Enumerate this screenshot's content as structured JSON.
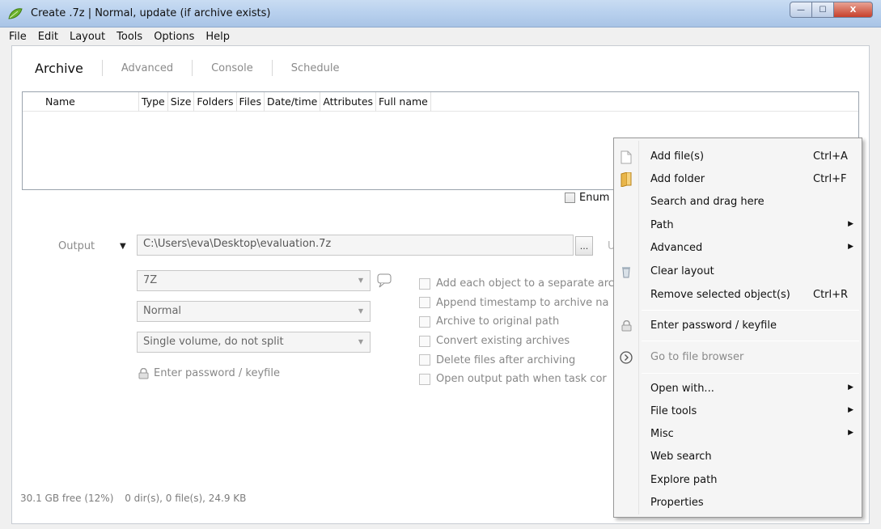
{
  "window": {
    "title": "Create .7z | Normal, update (if archive exists)",
    "buttons": {
      "minimize": "—",
      "maximize": "☐",
      "close": "X"
    }
  },
  "menubar": [
    "File",
    "Edit",
    "Layout",
    "Tools",
    "Options",
    "Help"
  ],
  "tabs": [
    "Archive",
    "Advanced",
    "Console",
    "Schedule"
  ],
  "active_tab": "Archive",
  "file_list": {
    "columns": [
      "Name",
      "Type",
      "Size",
      "Folders",
      "Files",
      "Date/time",
      "Attributes",
      "Full name"
    ],
    "rows": []
  },
  "enum_checkbox_label": "Enum",
  "output": {
    "label": "Output",
    "caret": "▼",
    "path": "C:\\Users\\eva\\Desktop\\evaluation.7z",
    "browse_label": "...",
    "side_label": "U"
  },
  "format_select": "7Z",
  "level_select": "Normal",
  "split_select": "Single volume, do not split",
  "password_link": "Enter password / keyfile",
  "options": [
    "Add each object to a separate arc",
    "Append timestamp to archive na",
    "Archive to original path",
    "Convert existing archives",
    "Delete files after archiving",
    "Open output path when task cor"
  ],
  "status": {
    "free": "30.1 GB free (12%)",
    "summary": "0 dir(s), 0 file(s), 24.9 KB"
  },
  "context_menu": {
    "items": [
      {
        "label": "Add file(s)",
        "shortcut": "Ctrl+A",
        "icon": "file-icon"
      },
      {
        "label": "Add folder",
        "shortcut": "Ctrl+F",
        "icon": "folder-icon"
      },
      {
        "label": "Search and drag here",
        "shortcut": "",
        "icon": ""
      },
      {
        "label": "Path",
        "shortcut": "",
        "icon": "",
        "submenu": true
      },
      {
        "label": "Advanced",
        "shortcut": "",
        "icon": "",
        "submenu": true
      },
      {
        "label": "Clear layout",
        "shortcut": "",
        "icon": "trash-icon"
      },
      {
        "label": "Remove selected object(s)",
        "shortcut": "Ctrl+R",
        "icon": ""
      },
      {
        "label": "Enter password / keyfile",
        "shortcut": "",
        "icon": "lock-icon"
      },
      {
        "label": "Go to file browser",
        "shortcut": "",
        "icon": "circle-arrow-icon",
        "disabled": true
      },
      {
        "label": "Open with...",
        "shortcut": "",
        "icon": "",
        "submenu": true
      },
      {
        "label": "File tools",
        "shortcut": "",
        "icon": "",
        "submenu": true
      },
      {
        "label": "Misc",
        "shortcut": "",
        "icon": "",
        "submenu": true
      },
      {
        "label": "Web search",
        "shortcut": "",
        "icon": ""
      },
      {
        "label": "Explore path",
        "shortcut": "",
        "icon": ""
      },
      {
        "label": "Properties",
        "shortcut": "",
        "icon": ""
      }
    ],
    "submenu_arrow": "▶"
  },
  "colors": {
    "titlebar": "#b9d1ee",
    "window_bg": "#ffffff",
    "menu_bg": "#f5f5f5",
    "disabled_text": "#8a8a8a"
  }
}
